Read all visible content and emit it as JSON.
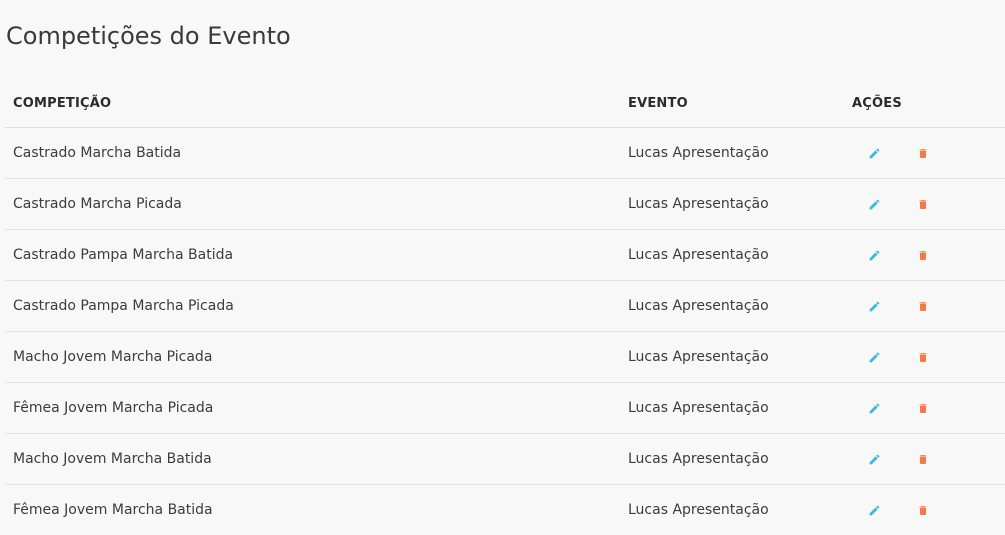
{
  "page": {
    "title": "Competições do Evento"
  },
  "colors": {
    "edit_icon": "#3bb8dc",
    "delete_icon": "#f07a4a"
  },
  "icons": {
    "edit": "pencil-icon",
    "delete": "trash-icon"
  },
  "table": {
    "headers": {
      "competition": "COMPETIÇÃO",
      "event": "EVENTO",
      "actions": "AÇÕES"
    },
    "rows": [
      {
        "competition": "Castrado Marcha Batida",
        "event": "Lucas Apresentação"
      },
      {
        "competition": "Castrado Marcha Picada",
        "event": "Lucas Apresentação"
      },
      {
        "competition": "Castrado Pampa Marcha Batida",
        "event": "Lucas Apresentação"
      },
      {
        "competition": "Castrado Pampa Marcha Picada",
        "event": "Lucas Apresentação"
      },
      {
        "competition": "Macho Jovem Marcha Picada",
        "event": "Lucas Apresentação"
      },
      {
        "competition": "Fêmea Jovem Marcha Picada",
        "event": "Lucas Apresentação"
      },
      {
        "competition": "Macho Jovem Marcha Batida",
        "event": "Lucas Apresentação"
      },
      {
        "competition": "Fêmea Jovem Marcha Batida",
        "event": "Lucas Apresentação"
      }
    ]
  }
}
